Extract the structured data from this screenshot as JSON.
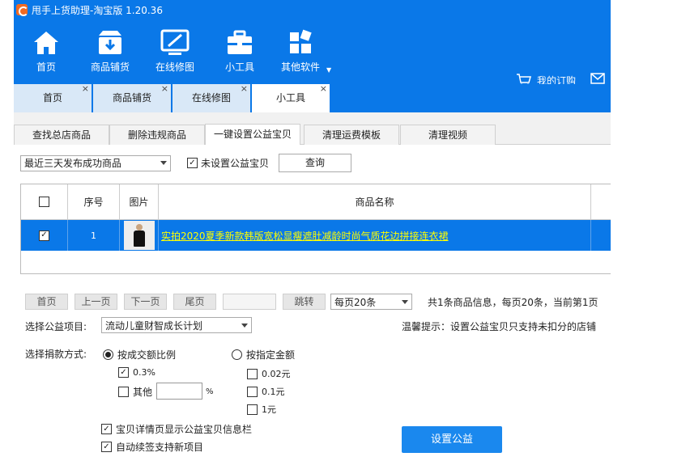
{
  "app": {
    "title": "甩手上货助理-淘宝版 1.20.36"
  },
  "toolbar": {
    "items": [
      {
        "label": "首页",
        "icon": "home-icon"
      },
      {
        "label": "商品铺货",
        "icon": "box-icon"
      },
      {
        "label": "在线修图",
        "icon": "image-edit-icon"
      },
      {
        "label": "小工具",
        "icon": "toolbox-icon"
      },
      {
        "label": "其他软件",
        "icon": "apps-icon"
      }
    ],
    "order_label": "我的订购"
  },
  "doc_tabs": [
    {
      "label": "首页",
      "close": "×"
    },
    {
      "label": "商品铺货",
      "close": "×"
    },
    {
      "label": "在线修图",
      "close": "×"
    },
    {
      "label": "小工具",
      "close": "×",
      "active": true
    }
  ],
  "sub_tabs": [
    {
      "label": "查找总店商品"
    },
    {
      "label": "删除违规商品"
    },
    {
      "label": "一键设置公益宝贝",
      "active": true
    },
    {
      "label": "清理运费模板"
    },
    {
      "label": "清理视频"
    }
  ],
  "filter": {
    "range_value": "最近三天发布成功商品",
    "unset_label": "未设置公益宝贝",
    "unset_checked": true,
    "query_button": "查询"
  },
  "table": {
    "columns": [
      "序号",
      "图片",
      "商品名称"
    ],
    "rows": [
      {
        "checked": true,
        "index": "1",
        "name": "实拍2020夏季新款韩版宽松显瘦遮肚减龄时尚气质花边拼接连衣裙"
      }
    ]
  },
  "pager": {
    "first": "首页",
    "prev": "上一页",
    "next": "下一页",
    "last": "尾页",
    "jump": "跳转",
    "page_size": "每页20条",
    "summary": "共1条商品信息，每页20条，当前第1页"
  },
  "charity": {
    "project_label": "选择公益项目:",
    "project_value": "流动儿童财智成长计划",
    "tip": "温馨提示：设置公益宝贝只支持未扣分的店铺",
    "method_label": "选择捐款方式:",
    "by_ratio_label": "按成交额比例",
    "by_amount_label": "按指定金额",
    "ratio_options": [
      {
        "label": "0.3%",
        "checked": true
      },
      {
        "label": "其他",
        "checked": false
      }
    ],
    "percent_sign": "%",
    "amount_options": [
      {
        "label": "0.02元",
        "checked": false
      },
      {
        "label": "0.1元",
        "checked": false
      },
      {
        "label": "1元",
        "checked": false
      }
    ],
    "show_info_label": "宝贝详情页显示公益宝贝信息栏",
    "auto_renew_label": "自动续签支持新项目",
    "submit_button": "设置公益"
  },
  "colors": {
    "accent": "#0a78e8",
    "row_selected": "#0a78e8",
    "link_yellow": "#ffff00"
  }
}
